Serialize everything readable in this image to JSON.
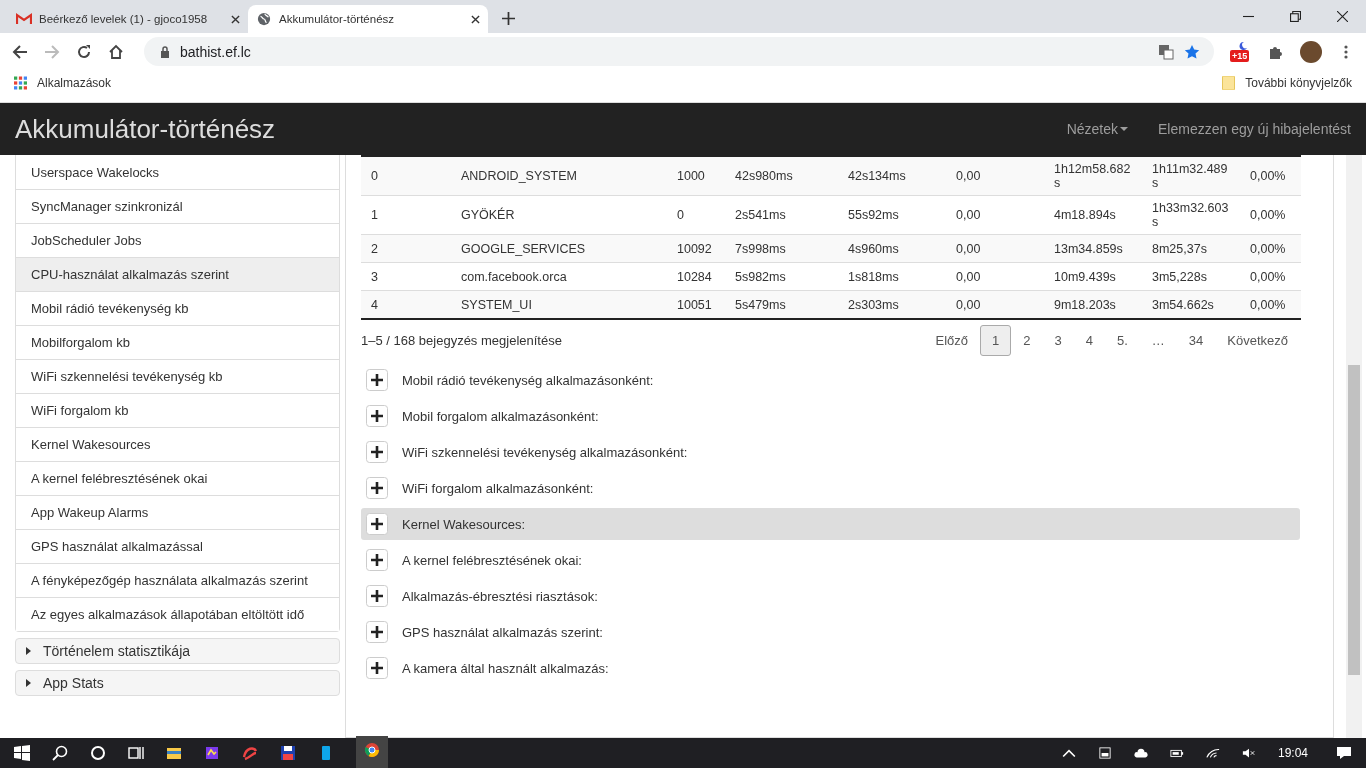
{
  "browser": {
    "tabs": [
      {
        "title": "Beérkező levelek (1) - gjoco1958",
        "selected": false
      },
      {
        "title": "Akkumulátor-történész",
        "selected": true
      }
    ],
    "url": "bathist.ef.lc",
    "extension_badge": "+15",
    "bookmarks": [
      {
        "label": "Alkalmazások"
      },
      {
        "label": "További könyvjelzők"
      }
    ]
  },
  "navbar": {
    "brand": "Akkumulátor-történész",
    "menu": "Nézetek",
    "link": "Elemezzen egy új hibajelentést"
  },
  "sidebar": {
    "items": [
      {
        "label": "Userspace Wakelocks",
        "selected": false
      },
      {
        "label": "SyncManager szinkronizál",
        "selected": false
      },
      {
        "label": "JobScheduler Jobs",
        "selected": false
      },
      {
        "label": "CPU-használat alkalmazás szerint",
        "selected": true
      },
      {
        "label": "Mobil rádió tevékenység kb",
        "selected": false
      },
      {
        "label": "Mobilforgalom kb",
        "selected": false
      },
      {
        "label": "WiFi szkennelési tevékenység kb",
        "selected": false
      },
      {
        "label": "WiFi forgalom kb",
        "selected": false
      },
      {
        "label": "Kernel Wakesources",
        "selected": false
      },
      {
        "label": "A kernel felébresztésének okai",
        "selected": false
      },
      {
        "label": "App Wakeup Alarms",
        "selected": false
      },
      {
        "label": "GPS használat alkalmazással",
        "selected": false
      },
      {
        "label": "A fényképezőgép használata alkalmazás szerint",
        "selected": false
      },
      {
        "label": "Az egyes alkalmazások állapotában eltöltött idő",
        "selected": false
      }
    ],
    "sections": [
      {
        "label": "Történelem statisztikája",
        "expanded": false
      },
      {
        "label": "App Stats",
        "expanded": false
      }
    ]
  },
  "table": {
    "rows": [
      [
        "0",
        "ANDROID_SYSTEM",
        "1000",
        "42s980ms",
        "42s134ms",
        "0,00",
        "1h12m58.682s",
        "1h11m32.489s",
        "0,00%"
      ],
      [
        "1",
        "GYÖKÉR",
        "0",
        "2s541ms",
        "55s92ms",
        "0,00",
        "4m18.894s",
        "1h33m32.603s",
        "0,00%"
      ],
      [
        "2",
        "GOOGLE_SERVICES",
        "10092",
        "7s998ms",
        "4s960ms",
        "0,00",
        "13m34.859s",
        "8m25,37s",
        "0,00%"
      ],
      [
        "3",
        "com.facebook.orca",
        "10284",
        "5s982ms",
        "1s818ms",
        "0,00",
        "10m9.439s",
        "3m5,228s",
        "0,00%"
      ],
      [
        "4",
        "SYSTEM_UI",
        "10051",
        "5s479ms",
        "2s303ms",
        "0,00",
        "9m18.203s",
        "3m54.662s",
        "0,00%"
      ]
    ],
    "info": "1–5 / 168 bejegyzés megjelenítése",
    "pagination": {
      "previous": "Előző",
      "pages": [
        {
          "label": "1",
          "selected": true
        },
        {
          "label": "2",
          "selected": false
        },
        {
          "label": "3",
          "selected": false
        },
        {
          "label": "4",
          "selected": false
        },
        {
          "label": "5.",
          "selected": false
        },
        {
          "label": "…",
          "selected": false
        },
        {
          "label": "34",
          "selected": false
        }
      ],
      "next": "Következő"
    }
  },
  "accordion": [
    {
      "title": "Mobil rádió tevékenység alkalmazásonként:",
      "highlighted": false
    },
    {
      "title": "Mobil forgalom alkalmazásonként:",
      "highlighted": false
    },
    {
      "title": "WiFi szkennelési tevékenység alkalmazásonként:",
      "highlighted": false
    },
    {
      "title": "WiFi forgalom alkalmazásonként:",
      "highlighted": false
    },
    {
      "title": "Kernel Wakesources:",
      "highlighted": true
    },
    {
      "title": "A kernel felébresztésének okai:",
      "highlighted": false
    },
    {
      "title": "Alkalmazás-ébresztési riasztások:",
      "highlighted": false
    },
    {
      "title": "GPS használat alkalmazás szerint:",
      "highlighted": false
    },
    {
      "title": "A kamera által használt alkalmazás:",
      "highlighted": false
    }
  ],
  "taskbar": {
    "time": "19:04"
  }
}
